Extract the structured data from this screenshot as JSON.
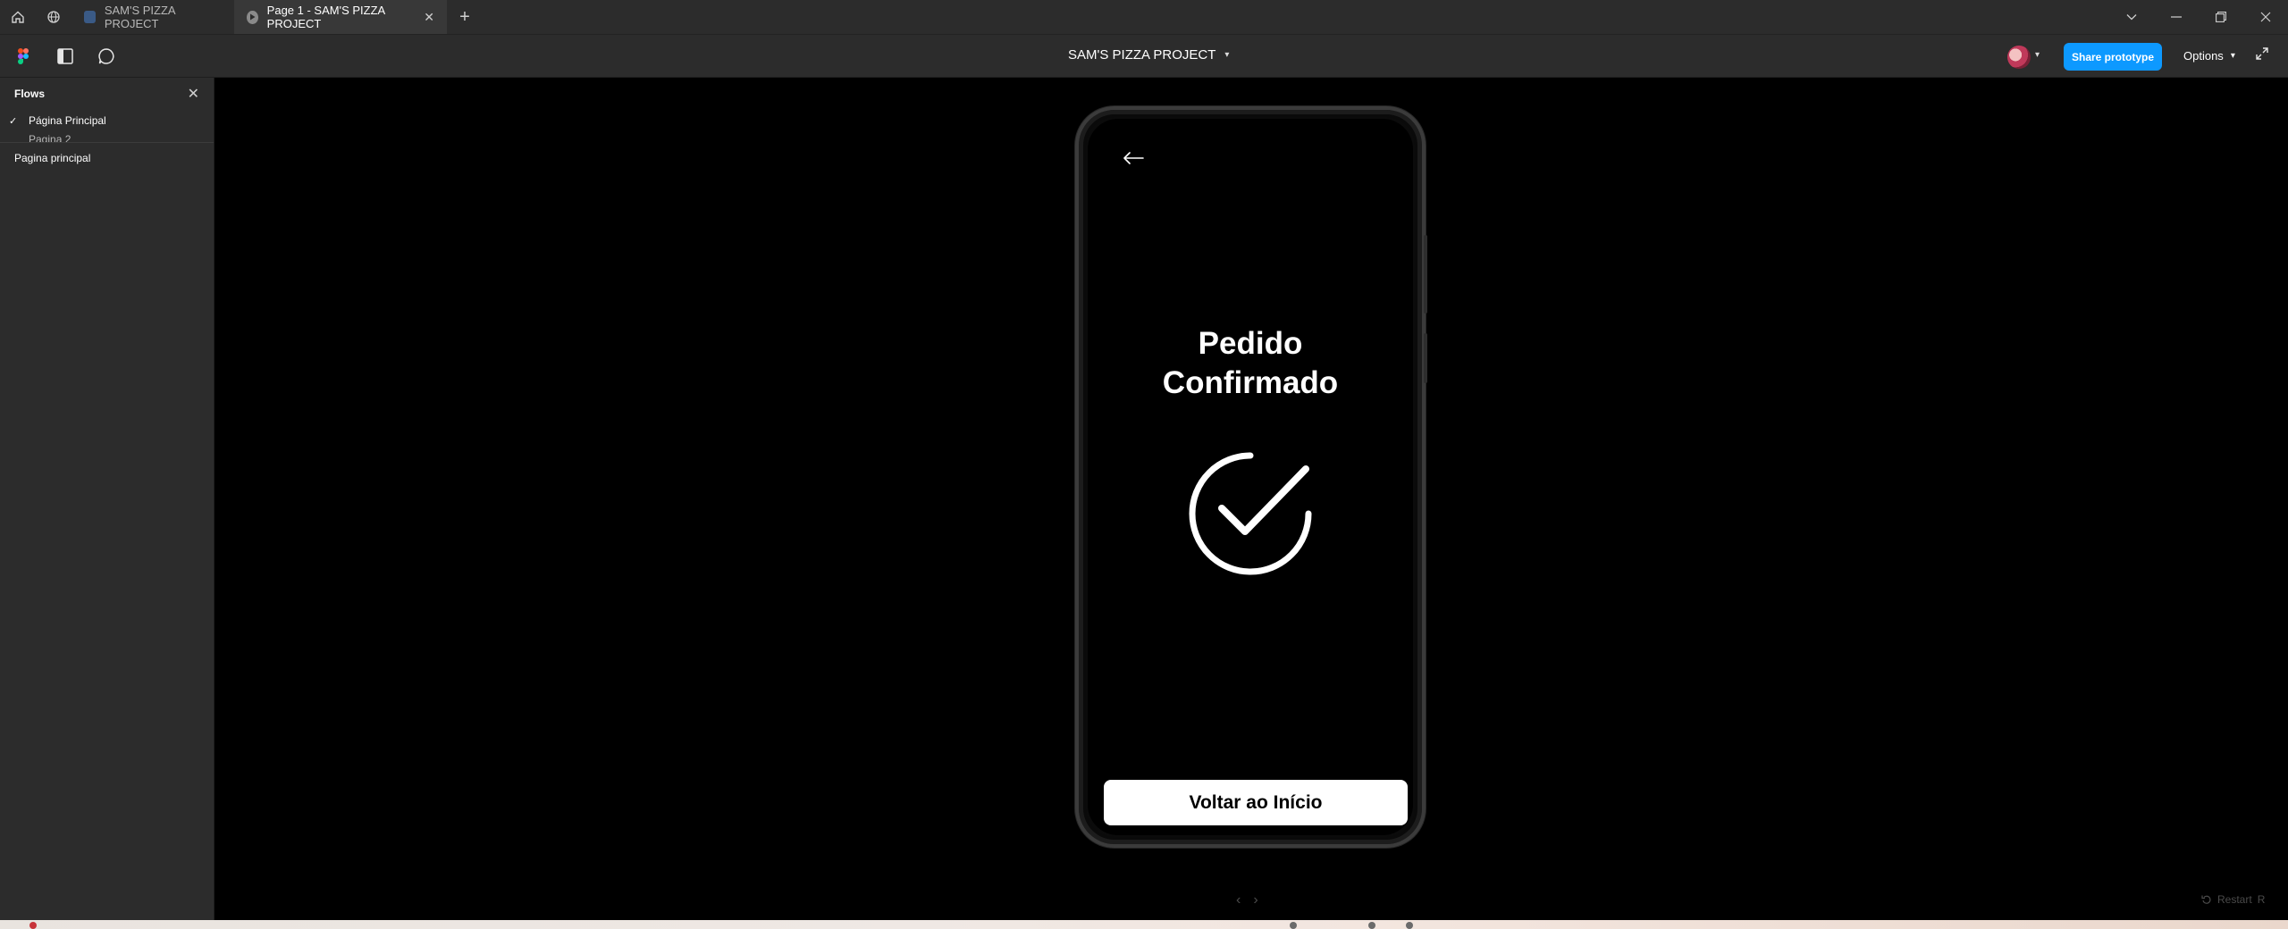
{
  "tabs": [
    {
      "label": "SAM'S PIZZA PROJECT",
      "active": false
    },
    {
      "label": "Page 1 - SAM'S PIZZA PROJECT",
      "active": true
    }
  ],
  "toolbar": {
    "doc_title": "SAM'S PIZZA PROJECT",
    "share_label": "Share prototype",
    "options_label": "Options"
  },
  "sidebar": {
    "title": "Flows",
    "flows": [
      {
        "label": "Página Principal",
        "selected": true
      },
      {
        "label": "Pagina 2",
        "selected": false
      }
    ],
    "page_label": "Pagina principal"
  },
  "prototype": {
    "heading_line1": "Pedido",
    "heading_line2": "Confirmado",
    "cta_label": "Voltar ao Início"
  },
  "footer": {
    "restart_label": "Restart"
  },
  "colors": {
    "accent": "#0d99ff",
    "chrome": "#2c2c2c",
    "canvas": "#000000"
  }
}
